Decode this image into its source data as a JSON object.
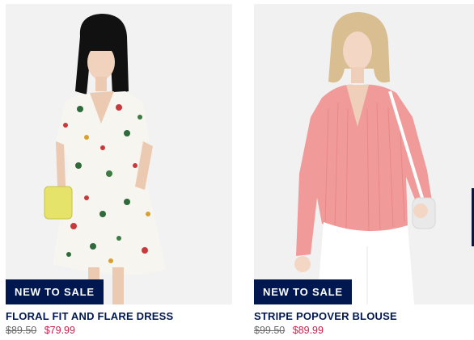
{
  "products": [
    {
      "name": "FLORAL FIT AND FLARE DRESS",
      "badge": "NEW TO SALE",
      "original_price": "$89.50",
      "sale_price": "$79.99",
      "image_icon": "product-photo-floral-dress"
    },
    {
      "name": "STRIPE POPOVER BLOUSE",
      "badge": "NEW TO SALE",
      "original_price": "$99.50",
      "sale_price": "$89.99",
      "image_icon": "product-photo-pink-blouse"
    }
  ],
  "colors": {
    "navy": "#00174f",
    "sale_red": "#cc1f4b",
    "strike_gray": "#6b6b6b",
    "photo_bg": "#f1f1f1"
  }
}
